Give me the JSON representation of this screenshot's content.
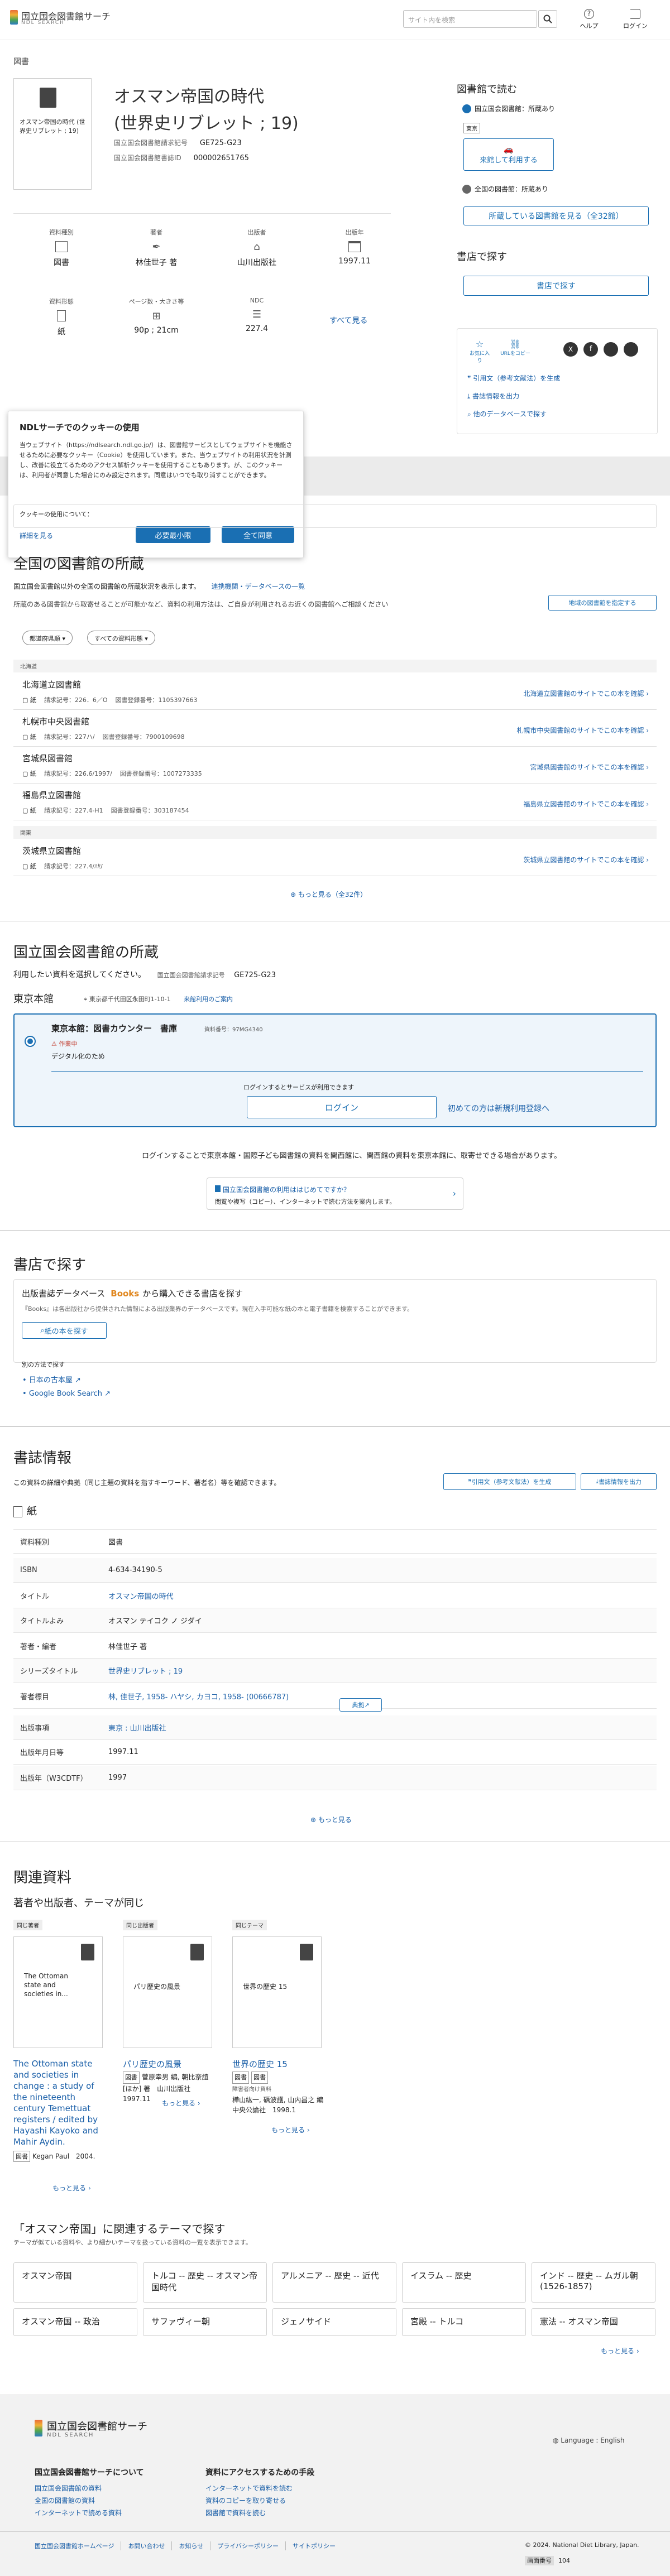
{
  "header": {
    "logo_jp": "国立国会図書館サーチ",
    "logo_en": "NDL SEARCH",
    "search_placeholder": "サイト内を検索",
    "help_label": "ヘルプ",
    "login_label": "ログイン"
  },
  "breadcrumb": "図書",
  "record": {
    "title_line1": "オスマン帝国の時代",
    "title_line2": "(世界史リブレット ; 19)",
    "cover_text": "オスマン帝国の時代 (世界史リブレット ; 19)",
    "callnum_label": "国立国会図書館請求記号",
    "callnum_value": "GE725-G23",
    "bibid_label": "国立国会図書館書誌ID",
    "bibid_value": "000002651765"
  },
  "summary": {
    "items": [
      {
        "label": "資料種別",
        "value": "図書",
        "link": false
      },
      {
        "label": "著者",
        "value": "林佳世子 著",
        "link": false
      },
      {
        "label": "出版者",
        "value": "山川出版社",
        "link": false
      },
      {
        "label": "出版年",
        "value": "1997.11",
        "link": false
      },
      {
        "label": "資料形態",
        "value": "紙",
        "link": false
      },
      {
        "label": "ページ数・大きさ等",
        "value": "90p ; 21cm",
        "link": false
      },
      {
        "label": "NDC",
        "value": "227.4",
        "link": false
      }
    ],
    "see_all": "すべて見る"
  },
  "sidebar": {
    "read_title": "図書館で読む",
    "ndl_label": "国立国会図書館：所蔵あり",
    "tokyo_badge": "東京",
    "reserve_btn": "来館して利用する",
    "all_libs_label": "全国の図書館：所蔵あり",
    "all_libs_btn": "所蔵している図書館を見る（全32館）",
    "buy_title": "書店で探す",
    "buy_btn": "書店で探す",
    "fav_label": "お気に入り",
    "url_label": "URLをコピー",
    "cite_label": "引用文（参考文献法）を生成",
    "export_label": "書誌情報を出力",
    "other_db_label": "他のデータベースで探す"
  },
  "cookie": {
    "title": "NDLサーチでのクッキーの使用",
    "body": "当ウェブサイト（https://ndlsearch.ndl.go.jp/）は、図書館サービスとしてウェブサイトを機能させるために必要なクッキー（Cookie）を使用しています。また、当ウェブサイトの利用状況を計測し、改善に役立てるためのアクセス解析クッキーを使用することもあります。が、このクッキーは、利用者が同意した場合にのみ設定されます。同意はいつでも取り消すことができます。",
    "question": "クッキーの使用について：",
    "detail_link": "詳細を見る",
    "essential_btn": "必要最小限",
    "accept_btn": "全て同意"
  },
  "all_libraries": {
    "title": "全国の図書館の所蔵",
    "desc": "国立国会図書館以外の全国の図書館の所蔵状況を表示します。",
    "desc_link": "連携機関・データベースの一覧",
    "note": "所蔵のある図書館から取寄せることが可能かなど、資料の利用方法は、ご自身が利用されるお近くの図書館へご相談ください",
    "region_btn": "地域の図書館を指定する",
    "filter1": "都道府県順",
    "filter2": "すべての資料形態",
    "region_hokkaido": "北海道",
    "region_kanto": "関東",
    "libraries": [
      {
        "name": "北海道立図書館",
        "form": "紙",
        "call": "請求記号：226．6／O",
        "bid": "図書登録番号：1105397663",
        "link": "北海道立図書館のサイトでこの本を確認"
      },
      {
        "name": "札幌市中央図書館",
        "form": "紙",
        "call": "請求記号：227ハ/",
        "bid": "図書登録番号：7900109698",
        "link": "札幌市中央図書館のサイトでこの本を確認"
      },
      {
        "name": "宮城県図書館",
        "form": "紙",
        "call": "請求記号：226.6/1997/",
        "bid": "図書登録番号：1007273335",
        "link": "宮城県図書館のサイトでこの本を確認"
      },
      {
        "name": "福島県立図書館",
        "form": "紙",
        "call": "請求記号：227.4-H1",
        "bid": "図書登録番号：303187454",
        "link": "福島県立図書館のサイトでこの本を確認"
      },
      {
        "name": "茨城県立図書館",
        "form": "紙",
        "call": "請求記号：227.4/ﾊﾔ/",
        "bid": "",
        "link": "茨城県立図書館のサイトでこの本を確認"
      }
    ],
    "more": "もっと見る（全32件）"
  },
  "ndl": {
    "title": "国立国会図書館の所蔵",
    "desc": "利用したい資料を選択してください。",
    "callnum_label": "国立国会図書館請求記号",
    "callnum_value": "GE725-G23",
    "tokyo_label": "東京本館",
    "address": "東京都千代田区永田町1-10-1",
    "howto_link": "来館利用のご案内",
    "counter": "東京本館：図書カウンター　書庫",
    "material_id": "資料番号：97MG4340",
    "status_tag": "作業中",
    "digital": "デジタル化のため",
    "login_note": "ログインするとサービスが利用できます",
    "login_btn": "ログイン",
    "register_link": "初めての方は新規利用登録へ",
    "transfer_note": "ログインすることで東京本館・国際子ども図書館の資料を関西館に、関西館の資料を東京本館に、取寄せできる場合があります。",
    "first_visit_title": "国立国会図書館の利用ははじめてですか？",
    "first_visit_desc": "閲覧や複写（コピー）、インターネットで読む方法を案内します。"
  },
  "bookstore": {
    "title": "書店で探す",
    "db_title_pre": "出版書誌データベース",
    "db_brand": "Books",
    "db_title_post": "から購入できる書店を探す",
    "db_desc": "『Books』は各出版社から提供された情報による出版業界のデータベースです。現在入手可能な紙の本と電子書籍を検索することができます。",
    "paper_btn": "紙の本を探す",
    "other_label": "別の方法で探す",
    "link1": "日本の古本屋",
    "link2": "Google Book Search"
  },
  "biblio": {
    "title": "書誌情報",
    "desc": "この資料の詳細や典拠（同じ主題の資料を指すキーワード、著者名）等を確認できます。",
    "cite_btn": "引用文（参考文献法）を生成",
    "export_btn": "書誌情報を出力",
    "form": "紙",
    "rows": [
      {
        "k": "資料種別",
        "v": "図書",
        "link": false
      },
      {
        "k": "ISBN",
        "v": "4-634-34190-5",
        "link": false
      },
      {
        "k": "タイトル",
        "v": "オスマン帝国の時代",
        "link": true
      },
      {
        "k": "タイトルよみ",
        "v": "オスマン テイコク ノ ジダイ",
        "link": false
      },
      {
        "k": "著者・編者",
        "v": "林佳世子 著",
        "link": false
      },
      {
        "k": "シリーズタイトル",
        "v": "世界史リブレット ; 19",
        "link": true
      },
      {
        "k": "著者標目",
        "v": "林, 佳世子, 1958- ハヤシ, カヨコ, 1958- (00666787)",
        "link": true
      },
      {
        "k": "出版事項",
        "v": "東京 : 山川出版社",
        "link": true
      },
      {
        "k": "出版年月日等",
        "v": "1997.11",
        "link": false
      },
      {
        "k": "出版年（W3CDTF）",
        "v": "1997",
        "link": false
      }
    ],
    "authority_btn": "典拠",
    "more": "もっと見る"
  },
  "related": {
    "title": "関連資料",
    "subtitle": "著者や出版者、テーマが同じ",
    "cards": [
      {
        "tag": "同じ著者",
        "cover": "The Ottoman state and societies in...",
        "title": "The Ottoman state and societies in change : a study of the nineteenth century Temettuat registers / edited by Hayashi Kayoko and Mahir Aydin.",
        "meta": "Kegan Paul　2004.",
        "more": "もっと見る"
      },
      {
        "tag": "同じ出版者",
        "cover": "パリ歴史の風景",
        "title": "パリ歴史の風景",
        "meta": "菅原幸男 編, 朝比奈誼 [ほか] 著　山川出版社　1997.11",
        "more": "もっと見る"
      },
      {
        "tag": "同じテーマ",
        "cover": "世界の歴史 15",
        "title": "世界の歴史 15",
        "meta": "樺山紘一, 礪波護, 山内昌之 編　中央公論社　1998.1",
        "sub": "障害者向け資料",
        "more": "もっと見る"
      }
    ]
  },
  "theme": {
    "title": "「オスマン帝国」に関連するテーマで探す",
    "desc": "テーマが似ている資料や、より細かいテーマを扱っている資料の一覧を表示できます。",
    "topics": [
      "オスマン帝国",
      "トルコ -- 歴史 -- オスマン帝国時代",
      "アルメニア -- 歴史 -- 近代",
      "イスラム -- 歴史",
      "インド -- 歴史 -- ムガル朝(1526-1857)",
      "オスマン帝国 -- 政治",
      "サファヴィー朝",
      "ジェノサイド",
      "宮殿 -- トルコ",
      "憲法 -- オスマン帝国"
    ],
    "more": "もっと見る"
  },
  "footer": {
    "logo_jp": "国立国会図書館サーチ",
    "logo_en": "NDL SEARCH",
    "language": "Language : English",
    "col1_title": "国立国会図書館サーチについて",
    "col1_links": [
      "国立国会図書館の資料",
      "全国の図書館の資料",
      "インターネットで読める資料"
    ],
    "col2_title": "資料にアクセスするための手段",
    "col2_links": [
      "インターネットで資料を読む",
      "資料のコピーを取り寄せる",
      "図書館で資料を読む"
    ],
    "bottom_links": [
      "国立国会図書館ホームページ",
      "お問い合わせ",
      "お知らせ",
      "プライバシーポリシー",
      "サイトポリシー"
    ],
    "copyright": "© 2024. National Diet Library, Japan.",
    "screen_label": "画面番号",
    "screen_no": "104"
  }
}
